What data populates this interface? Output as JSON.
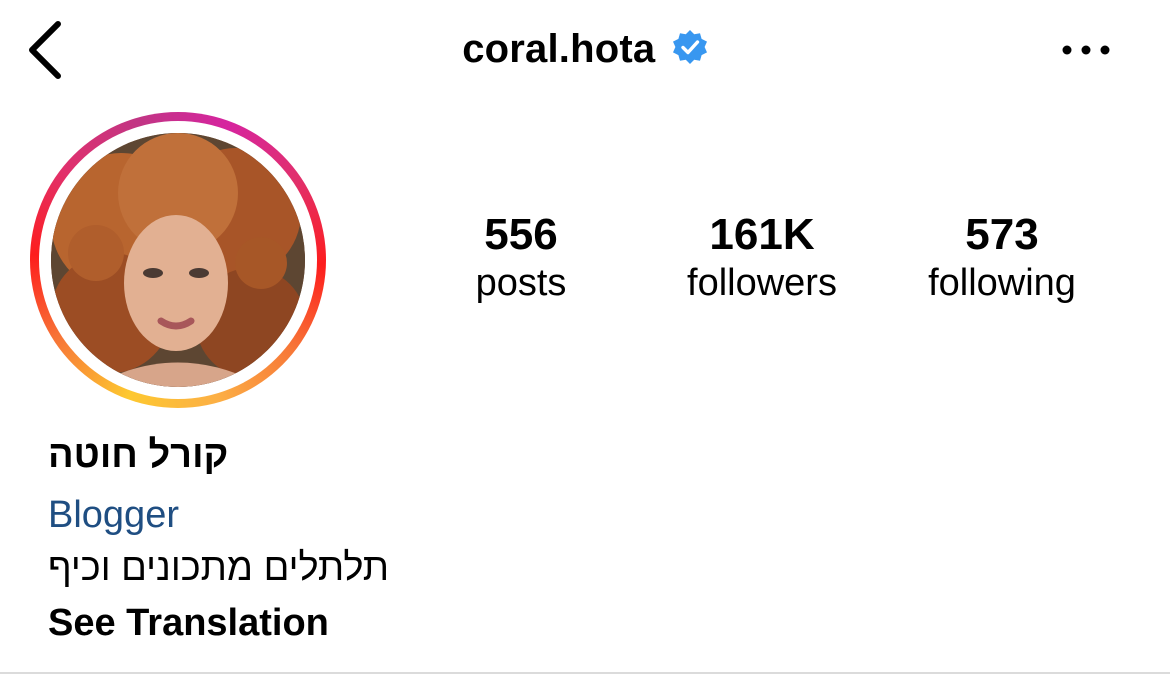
{
  "header": {
    "username": "coral.hota",
    "verified": true,
    "back_icon": "chevron-left-icon",
    "more_icon": "ellipsis-icon",
    "verified_color": "#3897f0"
  },
  "profile": {
    "avatar_icon": "profile-photo",
    "story_ring_colors": [
      "#fdc830",
      "#f77737",
      "#e1306c",
      "#c13584"
    ],
    "full_name": "קורל חוטה",
    "category": "Blogger",
    "bio": "תלתלים מתכונים וכיף",
    "see_translation": "See Translation",
    "category_color": "#1f4e82"
  },
  "stats": {
    "posts_value": "556",
    "posts_label": "posts",
    "followers_value": "161K",
    "followers_label": "followers",
    "following_value": "573",
    "following_label": "following"
  }
}
